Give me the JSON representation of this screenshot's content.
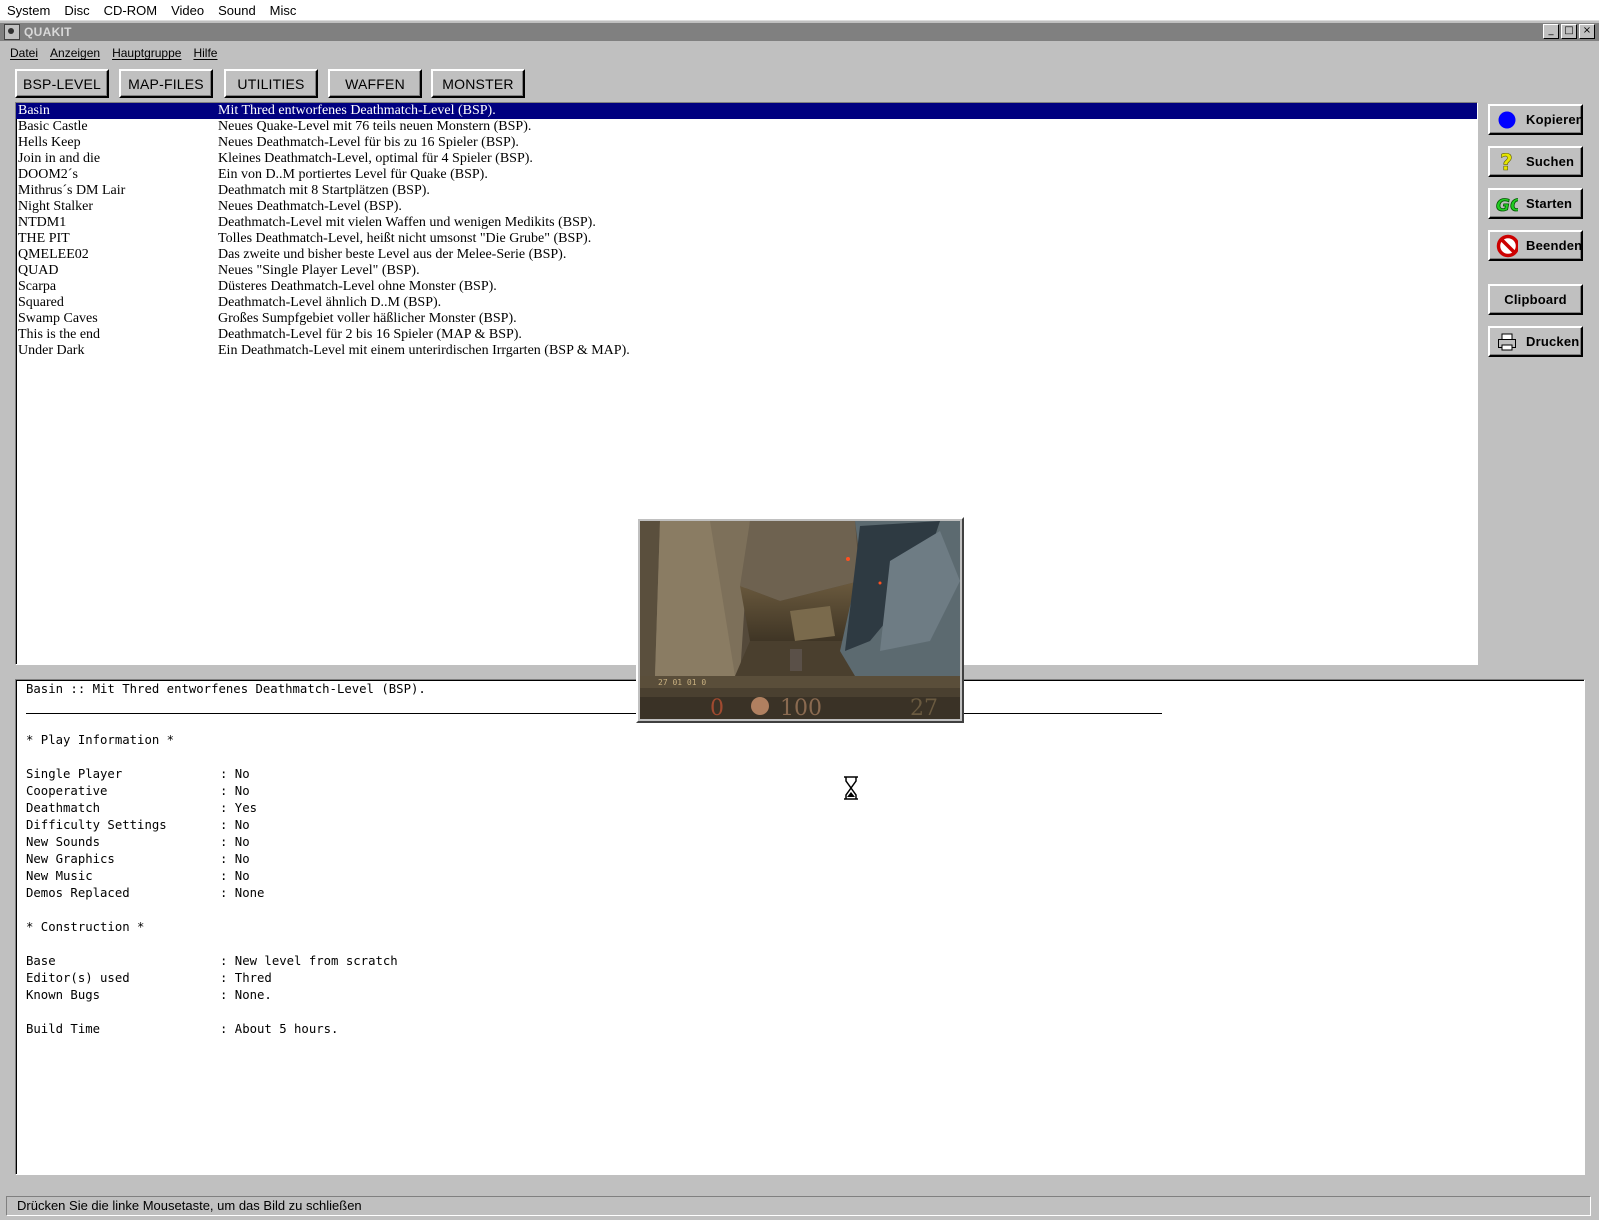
{
  "emulator_menu": [
    "System",
    "Disc",
    "CD-ROM",
    "Video",
    "Sound",
    "Misc"
  ],
  "window": {
    "title": "QUAKIT",
    "controls": {
      "minimize": "_",
      "maximize": "□",
      "close": "×"
    }
  },
  "app_menu": [
    "Datei",
    "Anzeigen",
    "Hauptgruppe",
    "Hilfe"
  ],
  "category_tabs": [
    "BSP-LEVEL",
    "MAP-FILES",
    "UTILITIES",
    "WAFFEN",
    "MONSTER"
  ],
  "side_buttons": [
    {
      "label": "Kopieren",
      "icon": "blue-circle-icon"
    },
    {
      "label": "Suchen",
      "icon": "question-mark-icon"
    },
    {
      "label": "Starten",
      "icon": "go-icon"
    },
    {
      "label": "Beenden",
      "icon": "no-entry-icon"
    },
    {
      "label": "Clipboard",
      "icon": ""
    },
    {
      "label": "Drucken",
      "icon": "printer-icon"
    }
  ],
  "colors": {
    "selection": "#000080",
    "face": "#c0c0c0",
    "title_inactive": "#808080"
  },
  "levels": [
    {
      "name": "Basin",
      "desc": "Mit Thred entworfenes Deathmatch-Level (BSP).",
      "selected": true
    },
    {
      "name": "Basic Castle",
      "desc": "Neues Quake-Level mit 76 teils neuen Monstern (BSP)."
    },
    {
      "name": "Hells Keep",
      "desc": "Neues Deathmatch-Level für bis zu 16 Spieler (BSP)."
    },
    {
      "name": "Join in and die",
      "desc": "Kleines Deathmatch-Level, optimal für 4 Spieler (BSP)."
    },
    {
      "name": "DOOM2´s",
      "desc": "Ein von D..M portiertes Level für Quake (BSP)."
    },
    {
      "name": "Mithrus´s DM Lair",
      "desc": "Deathmatch mit 8 Startplätzen (BSP)."
    },
    {
      "name": "Night Stalker",
      "desc": "Neues Deathmatch-Level (BSP)."
    },
    {
      "name": "NTDM1",
      "desc": "Deathmatch-Level mit vielen Waffen und wenigen Medikits (BSP)."
    },
    {
      "name": "THE PIT",
      "desc": "Tolles Deathmatch-Level, heißt nicht umsonst \"Die Grube\" (BSP)."
    },
    {
      "name": "QMELEE02",
      "desc": "Das zweite und bisher beste Level aus der Melee-Serie (BSP)."
    },
    {
      "name": "QUAD",
      "desc": "Neues \"Single Player Level\" (BSP)."
    },
    {
      "name": "Scarpa",
      "desc": "Düsteres Deathmatch-Level ohne Monster (BSP)."
    },
    {
      "name": "Squared",
      "desc": "Deathmatch-Level ähnlich D..M (BSP)."
    },
    {
      "name": "Swamp Caves",
      "desc": "Großes Sumpfgebiet voller häßlicher Monster (BSP)."
    },
    {
      "name": "This is the end",
      "desc": "Deathmatch-Level für 2 bis 16 Spieler (MAP & BSP)."
    },
    {
      "name": "Under Dark",
      "desc": "Ein Deathmatch-Level mit einem unterirdischen Irrgarten (BSP & MAP)."
    }
  ],
  "details": {
    "header": "Basin :: Mit Thred entworfenes Deathmatch-Level (BSP).",
    "play_heading": "* Play Information *",
    "play_info": [
      {
        "key": "Single Player",
        "value": ": No"
      },
      {
        "key": "Cooperative",
        "value": ": No"
      },
      {
        "key": "Deathmatch",
        "value": ": Yes"
      },
      {
        "key": "Difficulty Settings",
        "value": ": No"
      },
      {
        "key": "New Sounds",
        "value": ": No"
      },
      {
        "key": "New Graphics",
        "value": ": No"
      },
      {
        "key": "New Music",
        "value": ": No"
      },
      {
        "key": "Demos Replaced",
        "value": ": None"
      }
    ],
    "construction_heading": "* Construction *",
    "construction": [
      {
        "key": "Base",
        "value": ": New level from scratch"
      },
      {
        "key": "Editor(s) used",
        "value": ": Thred"
      },
      {
        "key": "Known Bugs",
        "value": ": None."
      }
    ],
    "build_time": {
      "key": "Build Time",
      "value": ": About 5 hours."
    }
  },
  "preview": {
    "hud_health": "100",
    "hud_ammo": "27"
  },
  "status_text": "Drücken Sie die linke Mousetaste, um das Bild zu schließen"
}
